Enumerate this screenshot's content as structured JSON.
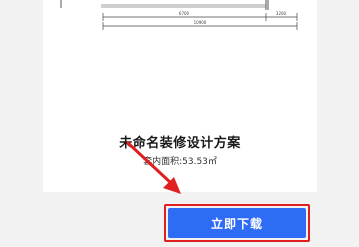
{
  "plan": {
    "title": "未命名装修设计方案",
    "area_label": "套内面积:",
    "area_value": "53.53㎡"
  },
  "drawing": {
    "dim_left": "6700",
    "dim_right": "3200",
    "dim_total": "10900"
  },
  "cta": {
    "download_label": "立即下载"
  },
  "colors": {
    "accent": "#2f6cf5",
    "highlight": "#e02020",
    "background": "#f2f2f3"
  },
  "icons": [
    "red-arrow-icon"
  ]
}
